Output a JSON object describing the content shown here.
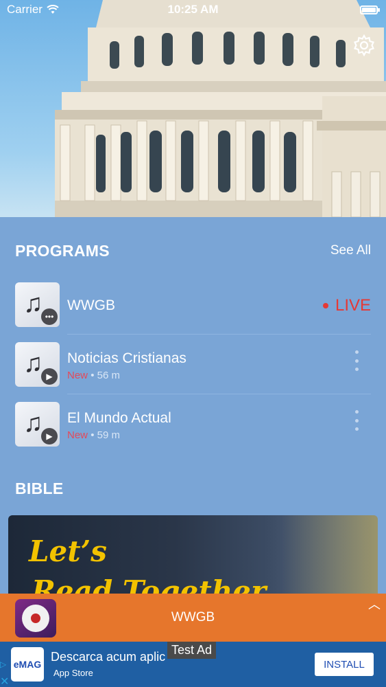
{
  "status_bar": {
    "carrier": "Carrier",
    "time": "10:25 AM"
  },
  "programs": {
    "title": "PROGRAMS",
    "see_all": "See All",
    "items": [
      {
        "title": "WWGB",
        "live_label": "LIVE"
      },
      {
        "title": "Noticias Cristianas",
        "new_label": "New",
        "duration": "56 m"
      },
      {
        "title": "El Mundo Actual",
        "new_label": "New",
        "duration": "59 m"
      }
    ]
  },
  "bible": {
    "title": "BIBLE",
    "card_line1": "Let’s",
    "card_line2": "Read Together"
  },
  "player": {
    "title": "WWGB"
  },
  "ad": {
    "brand": "eMAG",
    "title": "Descarca acum aplic",
    "store": "App Store",
    "install": "INSTALL",
    "test_label": "Test Ad"
  },
  "icons": [
    "wifi-icon",
    "battery-icon",
    "gear-icon",
    "music-note-icon",
    "play-icon",
    "more-dots-icon",
    "chevron-up-icon",
    "apple-icon",
    "adchoices-icon",
    "close-icon"
  ],
  "colors": {
    "background": "#7aa5d6",
    "accent_live": "#e53935",
    "accent_new": "#e34a5b",
    "player": "#e6762c",
    "ad": "#1f5fa3"
  }
}
